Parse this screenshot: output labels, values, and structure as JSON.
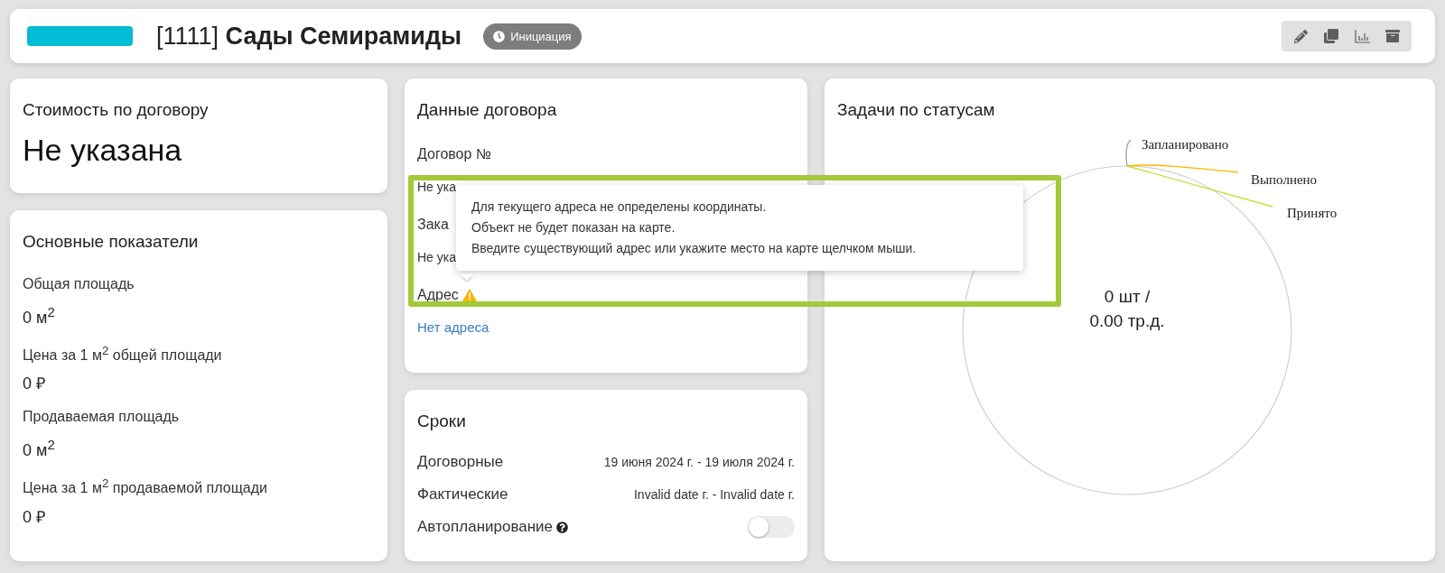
{
  "header": {
    "title": "[1111] **Сады Семирамиды**",
    "color": "#00bcd4",
    "status": "Инициация",
    "actions": [
      {
        "kind": "edit"
      },
      {
        "kind": "copy"
      },
      {
        "kind": "chart"
      },
      {
        "kind": "archive"
      }
    ]
  },
  "contract_cost": {
    "title": "Стоимость по договору",
    "value": "Не указана"
  },
  "indicators": {
    "title": "Основные показатели",
    "items": [
      {
        "label": "Общая площадь",
        "value": "0 м$^{2}$"
      },
      {
        "label": "Цена за 1 м$^{2}$ общей площади",
        "value": "0 ₽"
      },
      {
        "label": "Продаваемая площадь",
        "value": "0 м$^{2}$"
      },
      {
        "label": "Цена за 1 м$^{2}$ продаваемой площади",
        "value": "0 ₽"
      }
    ]
  },
  "contract_data": {
    "title": "Данные договора",
    "fields": [
      {
        "label": "Договор №",
        "value": "Не ука",
        "kind": "text",
        "warning": false
      },
      {
        "label": "Зака",
        "value": "Не ука",
        "kind": "text",
        "warning": false
      },
      {
        "label": "Адрес",
        "value": "Нет адреса",
        "kind": "link",
        "warning": true
      }
    ]
  },
  "tooltip": {
    "lines": [
      "Для текущего адреса не определены координаты.",
      "Объект не будет показан на карте.",
      "Введите существующий адрес или укажите место на карте щелчком мыши."
    ]
  },
  "terms": {
    "title": "Сроки",
    "rows": [
      {
        "label": "Договорные",
        "value": "19 июня 2024 г. - 19 июля 2024 г."
      },
      {
        "label": "Фактические",
        "value": "Invalid date г. - Invalid date г."
      }
    ],
    "autoplan": {
      "label": "Автопланирование",
      "on": false
    }
  },
  "tasks": {
    "title": "Задачи по статусам",
    "statuses": [
      {
        "label": "Запланировано",
        "color": "#9e9e9e"
      },
      {
        "label": "Выполнено",
        "color": "#ffb300"
      },
      {
        "label": "Принято",
        "color": "#c6e03a"
      }
    ],
    "center": [
      "0 шт /",
      "0.00 тр.д."
    ]
  }
}
